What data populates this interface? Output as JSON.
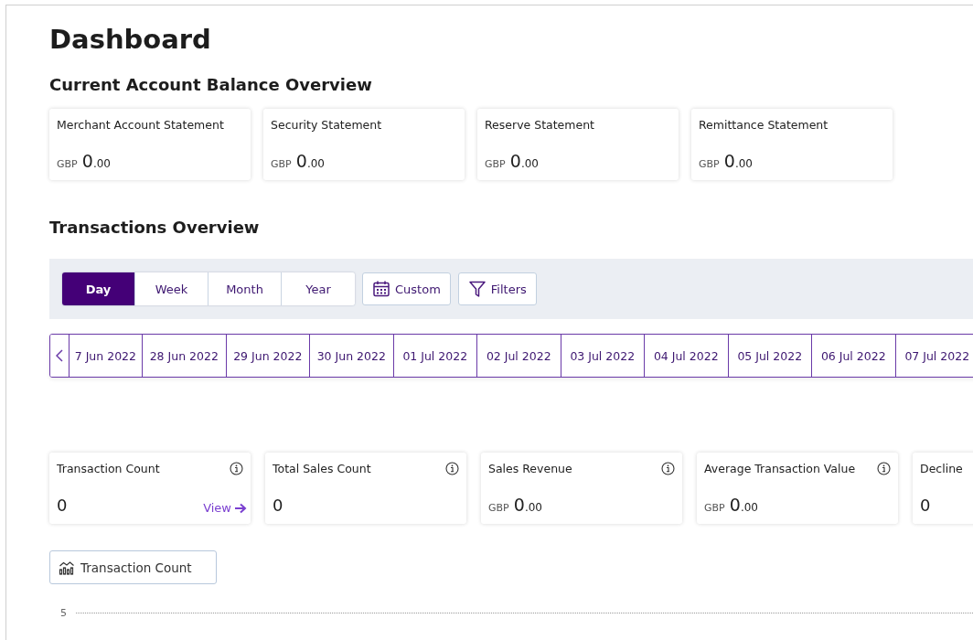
{
  "title": "Dashboard",
  "balance_section": {
    "heading": "Current Account Balance Overview",
    "cards": [
      {
        "label": "Merchant Account Statement",
        "currency": "GBP",
        "whole": "0",
        "fraction": ".00"
      },
      {
        "label": "Security Statement",
        "currency": "GBP",
        "whole": "0",
        "fraction": ".00"
      },
      {
        "label": "Reserve Statement",
        "currency": "GBP",
        "whole": "0",
        "fraction": ".00"
      },
      {
        "label": "Remittance Statement",
        "currency": "GBP",
        "whole": "0",
        "fraction": ".00"
      }
    ]
  },
  "transactions_section": {
    "heading": "Transactions Overview",
    "periods": [
      {
        "label": "Day",
        "selected": true
      },
      {
        "label": "Week",
        "selected": false
      },
      {
        "label": "Month",
        "selected": false
      },
      {
        "label": "Year",
        "selected": false
      }
    ],
    "custom_button": "Custom",
    "filters_button": "Filters",
    "dates": [
      "7 Jun 2022",
      "28 Jun 2022",
      "29 Jun 2022",
      "30 Jun 2022",
      "01 Jul 2022",
      "02 Jul 2022",
      "03 Jul 2022",
      "04 Jul 2022",
      "05 Jul 2022",
      "06 Jul 2022",
      "07 Jul 2022"
    ],
    "metrics": [
      {
        "kind": "count",
        "label": "Transaction Count",
        "value": "0",
        "link": "View",
        "info": true
      },
      {
        "kind": "count",
        "label": "Total Sales Count",
        "value": "0",
        "info": true
      },
      {
        "kind": "money",
        "label": "Sales Revenue",
        "currency": "GBP",
        "whole": "0",
        "fraction": ".00",
        "info": true
      },
      {
        "kind": "money",
        "label": "Average Transaction Value",
        "currency": "GBP",
        "whole": "0",
        "fraction": ".00",
        "info": true
      },
      {
        "kind": "count",
        "label": "Decline",
        "value": "0"
      }
    ],
    "chart_button": "Transaction Count",
    "chart_tick": "5"
  }
}
